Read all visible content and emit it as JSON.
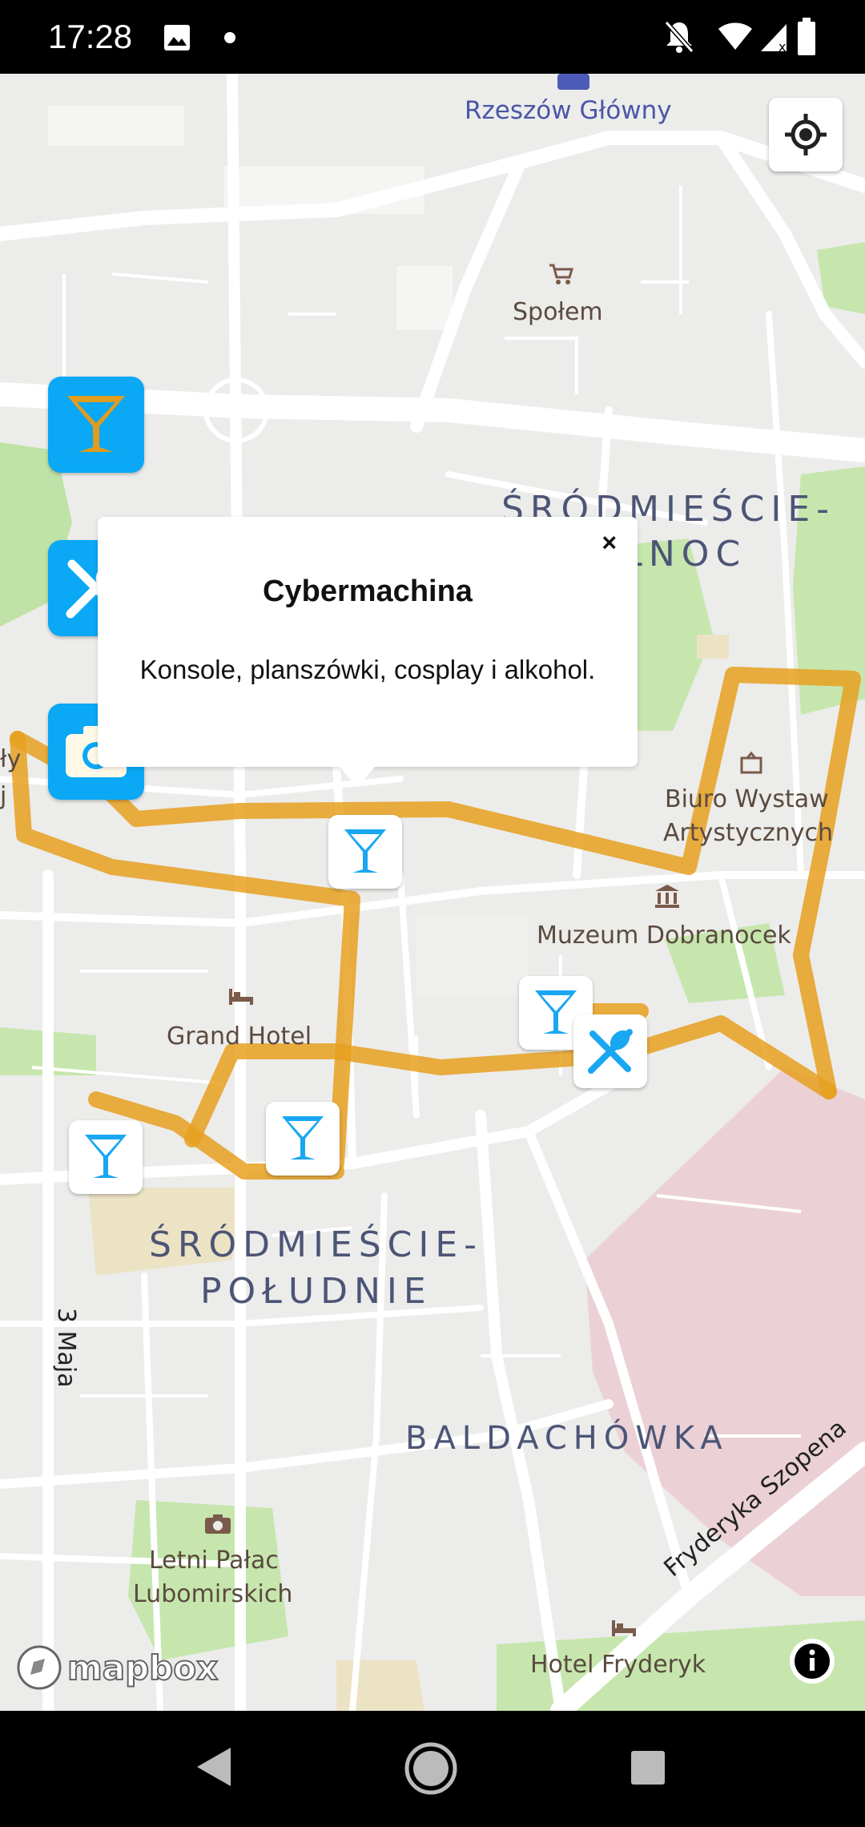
{
  "status_bar": {
    "time": "17:28"
  },
  "map": {
    "labels": {
      "station": "Rzeszów Główny",
      "shop": "Społem",
      "district_north_line1": "ŚRÓDMIEŚCIE-",
      "district_north_line2": "PÓŁNOC",
      "gallery_line1": "Biuro Wystaw",
      "gallery_line2": "Artystycznych",
      "museum": "Muzeum Dobranocek",
      "hotel1": "Grand Hotel",
      "district_south_line1": "ŚRÓDMIEŚCIE-",
      "district_south_line2": "POŁUDNIE",
      "street_3maja": "3 Maja",
      "district_balda": "BALDACHÓWKA",
      "street_szopena": "Fryderyka Szopena",
      "palace_line1": "Letni Pałac",
      "palace_line2": "Lubomirskich",
      "hotel2": "Hotel Fryderyk",
      "left_cut1": "ły",
      "left_cut2": "j"
    },
    "attribution": "mapbox",
    "route_color": "#e6a020"
  },
  "popup": {
    "title": "Cybermachina",
    "description": "Konsole, planszówki, cosplay i alkohol.",
    "close_label": "×"
  },
  "category_buttons": [
    {
      "name": "bars",
      "icon": "cocktail-icon"
    },
    {
      "name": "restaurants",
      "icon": "fork-spoon-icon"
    },
    {
      "name": "photo",
      "icon": "camera-icon"
    }
  ],
  "colors": {
    "accent": "#0aa8f5",
    "icon_blue": "#1aa7f2",
    "route": "#e6a020"
  }
}
